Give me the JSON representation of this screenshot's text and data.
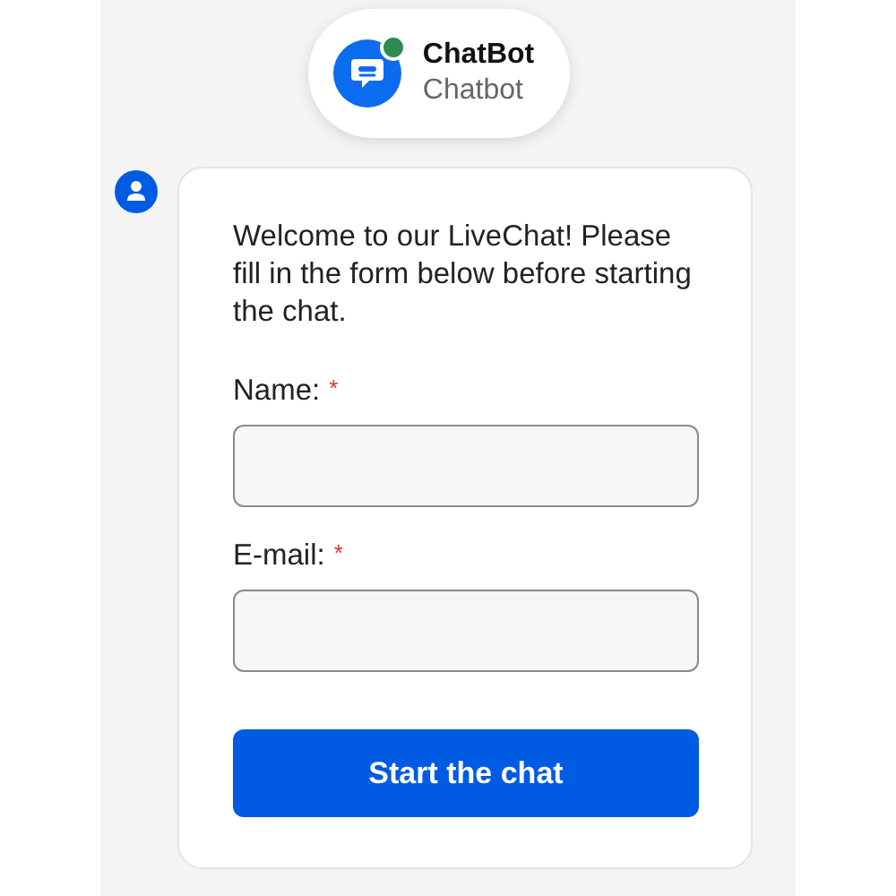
{
  "header": {
    "name": "ChatBot",
    "subtitle": "Chatbot",
    "online": true
  },
  "message": {
    "text": "Welcome to our LiveChat! Please fill in the form below before starting the chat."
  },
  "fields": [
    {
      "label": "Name:",
      "required": true,
      "required_mark": "*"
    },
    {
      "label": "E-mail:",
      "required": true,
      "required_mark": "*"
    }
  ],
  "submit_button": "Start the chat"
}
